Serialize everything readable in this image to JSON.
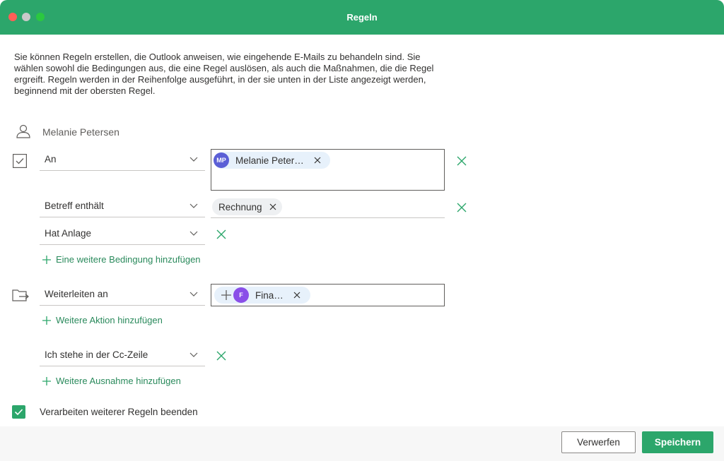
{
  "window": {
    "title": "Regeln"
  },
  "description": "Sie können Regeln erstellen, die Outlook anweisen, wie eingehende E-Mails zu behandeln sind. Sie wählen sowohl die Bedingungen aus, die eine Regel auslösen, als auch die Maßnahmen, die die Regel ergreift. Regeln werden in der Reihenfolge ausgeführt, in der sie unten in der Liste angezeigt werden, beginnend mit der obersten Regel.",
  "rule": {
    "name": "Melanie Petersen",
    "conditions": [
      {
        "type": "An",
        "recipient": {
          "initials": "MP",
          "name": "Melanie Peter…"
        }
      },
      {
        "type": "Betreff enthält",
        "keyword": "Rechnung"
      },
      {
        "type": "Hat Anlage"
      }
    ],
    "add_condition": "Eine weitere Bedingung hinzufügen",
    "action": {
      "type": "Weiterleiten an",
      "target": {
        "initials": "F",
        "name": "Fina…"
      }
    },
    "add_action": "Weitere Aktion hinzufügen",
    "exception": {
      "type": "Ich stehe in der Cc-Zeile"
    },
    "add_exception": "Weitere Ausnahme hinzufügen",
    "stop_processing": {
      "label": "Verarbeiten weiterer Regeln beenden",
      "checked": true
    }
  },
  "buttons": {
    "discard": "Verwerfen",
    "save": "Speichern"
  },
  "colors": {
    "accent": "#2ca66b",
    "avatar_mp": "#5b5fd6",
    "avatar_f": "#8a4fe8"
  }
}
